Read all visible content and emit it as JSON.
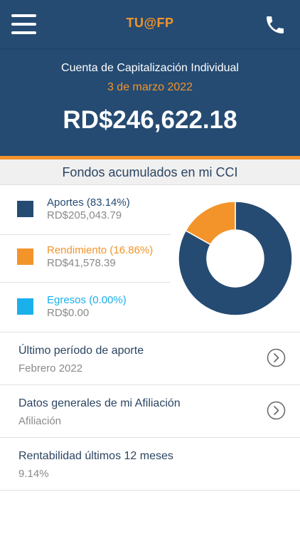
{
  "navbar": {
    "brand": "TU@FP",
    "menu_icon": "hamburger-menu-icon",
    "phone_icon": "phone-icon"
  },
  "header": {
    "title": "Cuenta de Capitalización Individual",
    "date": "3 de marzo 2022",
    "amount": "RD$246,622.18"
  },
  "colors": {
    "primary": "#254b72",
    "accent": "#f3942a",
    "aportes": "#254b72",
    "rendimiento": "#f3942a",
    "egresos": "#1ab0ec"
  },
  "funds": {
    "title": "Fondos acumulados en mi CCI",
    "items": [
      {
        "label": "Aportes (83.14%)",
        "value": "RD$205,043.79",
        "percent": 83.14,
        "color": "#254b72"
      },
      {
        "label": "Rendimiento (16.86%)",
        "value": "RD$41,578.39",
        "percent": 16.86,
        "color": "#f3942a"
      },
      {
        "label": "Egresos (0.00%)",
        "value": "RD$0.00",
        "percent": 0.0,
        "color": "#1ab0ec"
      }
    ]
  },
  "rows": [
    {
      "label": "Último período de aporte",
      "value": "Febrero 2022",
      "chevron_icon": "chevron-right-circle-icon"
    },
    {
      "label": "Datos generales de mi Afiliación",
      "value": "Afiliación",
      "chevron_icon": "chevron-right-circle-icon"
    },
    {
      "label": "Rentabilidad últimos 12 meses",
      "value": "9.14%"
    }
  ]
}
